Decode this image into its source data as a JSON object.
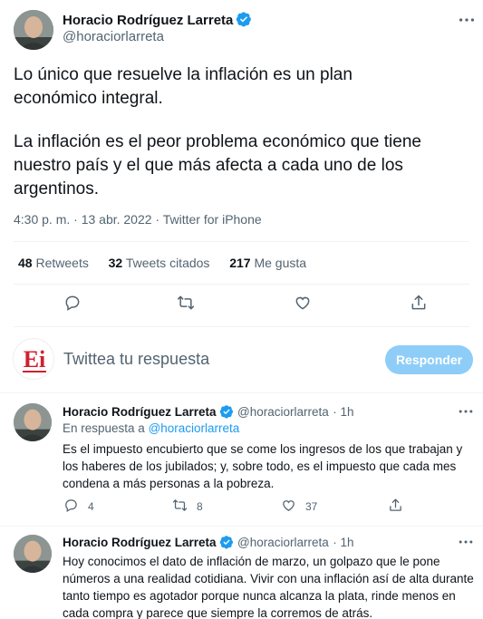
{
  "main_tweet": {
    "author_name": "Horacio Rodríguez Larreta",
    "author_handle": "@horaciorlarreta",
    "text_p1": "Lo único que resuelve la inflación es un plan\neconómico integral.",
    "text_p2": "La inflación es el peor problema económico que tiene\nnuestro país y el que más afecta a cada uno de los\nargentinos.",
    "timestamp": "4:30 p. m. · 13 abr. 2022 · Twitter for iPhone",
    "retweets_count": "48",
    "retweets_label": "Retweets",
    "quotes_count": "32",
    "quotes_label": "Tweets citados",
    "likes_count": "217",
    "likes_label": "Me gusta"
  },
  "reply_box": {
    "placeholder": "Twittea tu respuesta",
    "button_label": "Responder",
    "logo_text": "Ei"
  },
  "replies": [
    {
      "author_name": "Horacio Rodríguez Larreta",
      "author_handle": "@horaciorlarreta",
      "time": "· 1h",
      "in_reply_prefix": "En respuesta a ",
      "in_reply_handle": "@horaciorlarreta",
      "text": "Es el impuesto encubierto que se come los ingresos de los que trabajan y\nlos haberes de los jubilados; y, sobre todo, es el impuesto que cada mes\ncondena a más personas a la pobreza.",
      "reply_count": "4",
      "retweet_count": "8",
      "like_count": "37"
    },
    {
      "author_name": "Horacio Rodríguez Larreta",
      "author_handle": "@horaciorlarreta",
      "time": "· 1h",
      "text": "Hoy conocimos el dato de inflación de marzo, un golpazo que le pone\nnúmeros a una realidad cotidiana. Vivir con una inflación así de alta durante\ntanto tiempo es agotador porque nunca alcanza la plata, rinde menos en\ncada compra y parece que siempre la corremos de atrás."
    }
  ],
  "colors": {
    "accent": "#1d9bf0",
    "reply_button_disabled": "#8ecdf8",
    "secondary_text": "#536471",
    "divider": "#eff3f4",
    "logo_red": "#d0202e"
  },
  "icons": [
    "verified-badge-icon",
    "more-icon",
    "reply-icon",
    "retweet-icon",
    "like-icon",
    "share-icon"
  ]
}
